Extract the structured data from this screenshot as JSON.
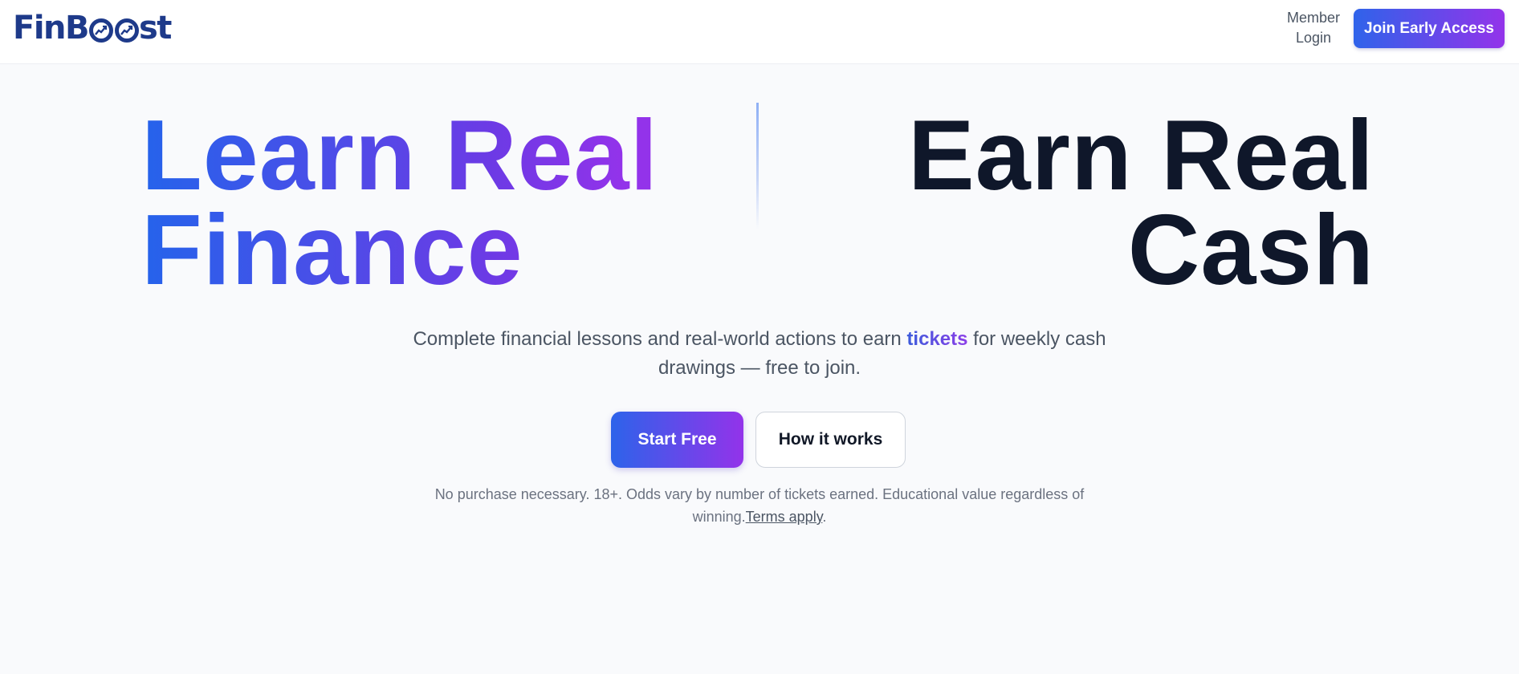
{
  "header": {
    "logo_text_prefix": "FinB",
    "logo_text_suffix": "st",
    "member_login_line1": "Member",
    "member_login_line2": "Login",
    "join_label": "Join Early Access"
  },
  "hero": {
    "left_line1": "Learn Real",
    "left_line2": "Finance",
    "right_line1": "Earn Real",
    "right_line2": "Cash",
    "subtitle_before": "Complete financial lessons and real-world actions to earn ",
    "subtitle_highlight": "tickets",
    "subtitle_after": " for weekly cash drawings — free to join.",
    "start_label": "Start Free",
    "how_label": "How it works",
    "disclaimer_text": "No purchase necessary. 18+. Odds vary by number of tickets earned. Educational value regardless of winning.",
    "terms_label": "Terms apply",
    "disclaimer_end": "."
  },
  "colors": {
    "brand_blue": "#2563eb",
    "brand_purple": "#9333ea",
    "logo_navy": "#1e3a8a",
    "headline_dark": "#0f172a"
  },
  "icons": [
    "chart-up-icon",
    "chart-up-icon"
  ]
}
